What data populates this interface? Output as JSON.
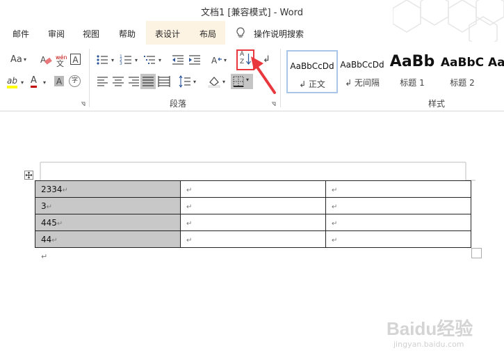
{
  "window": {
    "title": "文档1 [兼容模式]  -  Word"
  },
  "tabs": [
    {
      "label": "邮件"
    },
    {
      "label": "审阅"
    },
    {
      "label": "视图"
    },
    {
      "label": "帮助"
    },
    {
      "label": "表设计"
    },
    {
      "label": "布局"
    }
  ],
  "tell_me": {
    "label": "操作说明搜索",
    "icon": "lightbulb-icon"
  },
  "ribbon": {
    "font_group": {
      "change_case": "Aa",
      "phonetic_top": "wén",
      "phonetic_bottom": "文",
      "char_border": "A",
      "highlight_text": "ab",
      "font_color_letter": "A",
      "char_shading_letter": "A",
      "enclose_char": "字"
    },
    "paragraph_group": {
      "label": "段落"
    },
    "styles_group": {
      "label": "样式"
    },
    "sort": {
      "line1": "A",
      "line2": "Z",
      "icon": "sort-icon"
    },
    "styles": [
      {
        "sample": "AaBbCcDd",
        "label": "↲ 正文"
      },
      {
        "sample": "AaBbCcDd",
        "label": "↲ 无间隔"
      },
      {
        "sample": "AaBb",
        "label": "标题 1"
      },
      {
        "sample": "AaBbC",
        "label": "标题 2"
      },
      {
        "sample": "Aa",
        "label": ""
      }
    ]
  },
  "table": {
    "rows": [
      {
        "c1": "2334",
        "c2": "",
        "c3": ""
      },
      {
        "c1": "3",
        "c2": "",
        "c3": ""
      },
      {
        "c1": "445",
        "c2": "",
        "c3": ""
      },
      {
        "c1": "44",
        "c2": "",
        "c3": ""
      }
    ],
    "mark": "↵"
  },
  "watermark": {
    "logo": "Baidu经验",
    "url": "jingyan.baidu.com"
  },
  "colors": {
    "accent_red": "#e8383d",
    "highlight_yellow": "#ffff00",
    "font_red": "#c00000",
    "selection_gray": "#c8c8c8",
    "tab_highlight": "#fdf3e2"
  }
}
